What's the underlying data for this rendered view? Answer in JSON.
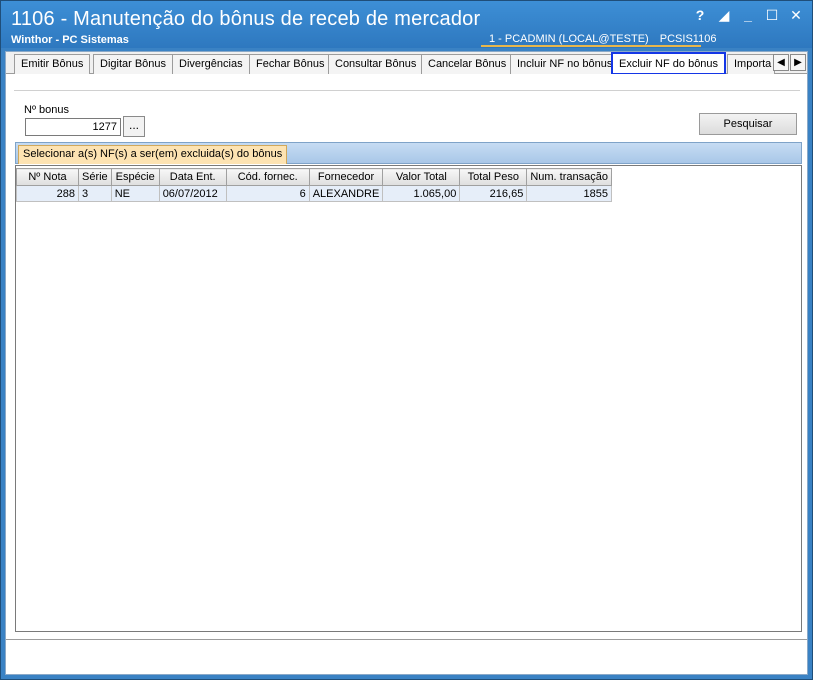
{
  "window": {
    "title": "1106 - Manutenção do bônus de receb de mercador",
    "subtitle": "Winthor - PC Sistemas",
    "user": "1 - PCADMIN (LOCAL@TESTE)",
    "program": "PCSIS1106",
    "buttons": {
      "help": "?",
      "restore": "◢",
      "minimize": "_",
      "maximize": "☐",
      "close": "✕"
    }
  },
  "tabs": [
    {
      "label": "Emitir Bônus"
    },
    {
      "label": "Digitar Bônus"
    },
    {
      "label": "Divergências"
    },
    {
      "label": "Fechar Bônus"
    },
    {
      "label": "Consultar Bônus"
    },
    {
      "label": "Cancelar Bônus"
    },
    {
      "label": "Incluir NF no bônus"
    },
    {
      "label": "Excluir NF do bônus"
    },
    {
      "label": "Importa"
    }
  ],
  "form": {
    "bonus_label": "Nº bonus",
    "bonus_value": "1277",
    "ellipsis": "...",
    "search_button": "Pesquisar"
  },
  "section": {
    "title": "Selecionar a(s) NF(s) a ser(em) excluida(s) do bônus"
  },
  "grid": {
    "columns": [
      "Nº Nota",
      "Série",
      "Espécie",
      "Data Ent.",
      "Cód. fornec.",
      "Fornecedor",
      "Valor Total",
      "Total Peso",
      "Num. transação"
    ],
    "rows": [
      [
        "288",
        "3",
        "NE",
        "06/07/2012",
        "6",
        "ALEXANDRE",
        "1.065,00",
        "216,65",
        "1855"
      ]
    ]
  },
  "colors": {
    "title_bar": "#2e78bf",
    "active_tab_border": "#1436e6",
    "section_tab": "#fde3b2"
  }
}
